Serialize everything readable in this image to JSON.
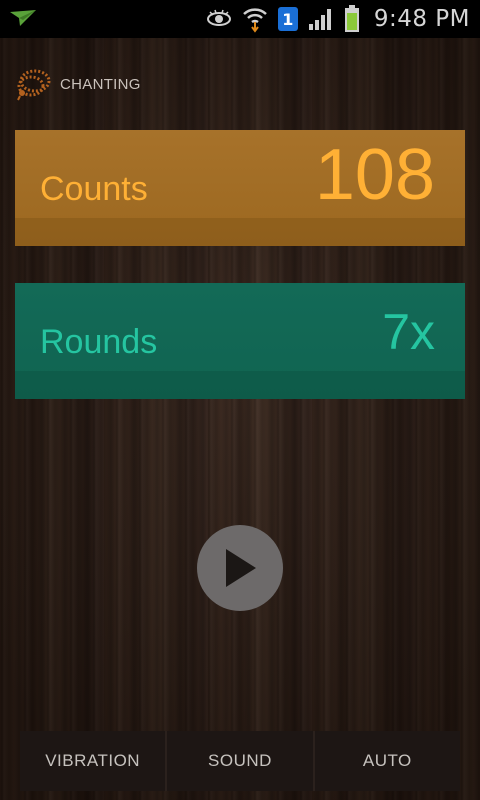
{
  "status_bar": {
    "time": "9:48 PM",
    "notification_badge": "1",
    "icons": [
      "paper-plane-icon",
      "eye-icon",
      "wifi-icon",
      "sim-badge-icon",
      "signal-icon",
      "battery-icon"
    ],
    "battery_color": "#8bc93a"
  },
  "header": {
    "title": "CHANTING",
    "icon": "beads-icon"
  },
  "counts": {
    "label": "Counts",
    "value": "108",
    "color": "#ffb035",
    "background": "#9f6a22"
  },
  "rounds": {
    "label": "Rounds",
    "value": "7x",
    "color": "#25c5a1",
    "background": "#126753"
  },
  "play_button": {
    "icon": "play-icon"
  },
  "bottom_bar": {
    "vibration_label": "VIBRATION",
    "sound_label": "SOUND",
    "auto_label": "AUTO"
  }
}
